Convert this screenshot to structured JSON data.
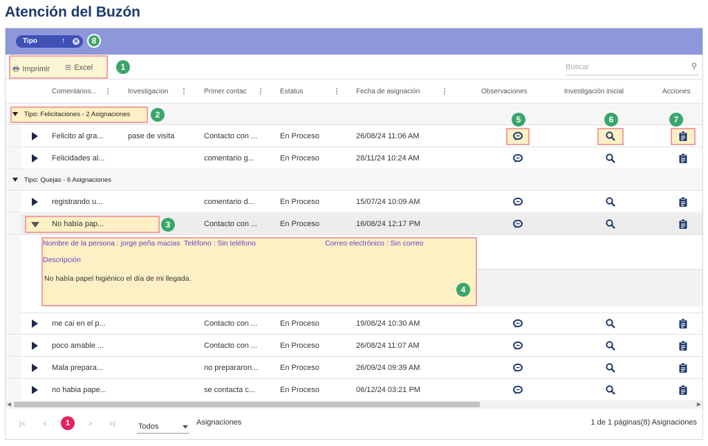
{
  "page": {
    "title": "Atención del Buzón"
  },
  "group_panel": {
    "chip_label": "Tipo",
    "chip_sort_icon": "arrow-up-icon",
    "chip_remove_icon": "close-circle-icon"
  },
  "badges": {
    "b1": "1",
    "b2": "2",
    "b3": "3",
    "b4": "4",
    "b5": "5",
    "b6": "6",
    "b7": "7",
    "b8": "8"
  },
  "toolbar": {
    "print_label": "Imprimir",
    "excel_label": "Excel",
    "print_icon": "printer-icon",
    "excel_icon": "excel-icon"
  },
  "search": {
    "placeholder": "Buscar"
  },
  "columns": [
    "Comentarios...",
    "Investigacion",
    "Primer contac",
    "Estatus",
    "Fecha de asignación",
    "Observaciones",
    "Investigación inicial",
    "Acciones"
  ],
  "groups": [
    {
      "label": "Tipo: Felicitaciones - 2 Asignaciones",
      "rows": [
        {
          "comentarios": "Felicito al gra...",
          "investigacion": "pase de visita",
          "primer": "Contacto con ...",
          "estatus": "En Proceso",
          "fecha": "26/08/24 11:06 AM"
        },
        {
          "comentarios": "Felicidades al...",
          "investigacion": "",
          "primer": "comentario g...",
          "estatus": "En Proceso",
          "fecha": "28/11/24 10:24 AM"
        }
      ]
    },
    {
      "label": "Tipo: Quejas - 6 Asignaciones",
      "rows": [
        {
          "comentarios": "registrando u...",
          "investigacion": "",
          "primer": "comentario d...",
          "estatus": "En Proceso",
          "fecha": "15/07/24 10:09 AM"
        },
        {
          "comentarios": "No había pap...",
          "investigacion": "",
          "primer": "Contacto con ...",
          "estatus": "En Proceso",
          "fecha": "16/08/24 12:17 PM"
        },
        {
          "comentarios": "me cai en el p...",
          "investigacion": "",
          "primer": "Contacto con ...",
          "estatus": "En Proceso",
          "fecha": "19/08/24 10:30 AM"
        },
        {
          "comentarios": "poco amable ...",
          "investigacion": "",
          "primer": "Contacto con ...",
          "estatus": "En Proceso",
          "fecha": "26/08/24 11:07 AM"
        },
        {
          "comentarios": "Mala prepara...",
          "investigacion": "",
          "primer": "no prepararon...",
          "estatus": "En Proceso",
          "fecha": "26/09/24 09:39 AM"
        },
        {
          "comentarios": "no habia pape...",
          "investigacion": "",
          "primer": "se contacta c...",
          "estatus": "En Proceso",
          "fecha": "06/12/24 03:21 PM"
        }
      ]
    }
  ],
  "detail": {
    "nombre": "Nombre de la persona : jorge peña macias",
    "telefono": "Teléfono : Sin teléfono",
    "correo": "Correo electrónico : Sin correo",
    "descripcion_label": "Descripción",
    "descripcion": "No había papel higiénico el día de mi llegada."
  },
  "pager": {
    "first": "|<",
    "prev": "<",
    "current": "1",
    "next": ">",
    "last": ">|",
    "page_size": "Todos",
    "label": "Asignaciones",
    "info": "1 de 1 páginas(8) Asignaciones"
  },
  "icons": {
    "observaciones": "comment-icon",
    "investigacion": "magnifier-icon",
    "acciones": "clipboard-icon"
  },
  "colors": {
    "title": "#1c3a6e",
    "group_panel": "#8e97d9",
    "chip": "#3f51b5",
    "badge": "#3aa66b",
    "highlight_fill": "#fdf0c4",
    "highlight_border": "#f0a0a0",
    "pager_current": "#e0245e",
    "detail_text": "#6a3ec7"
  }
}
